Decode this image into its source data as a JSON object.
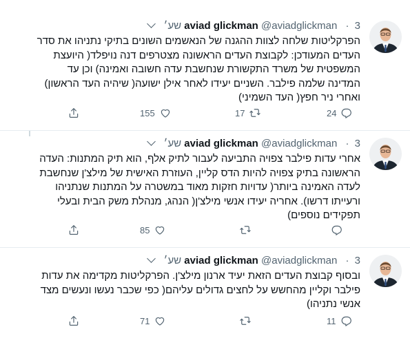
{
  "tweets": [
    {
      "name": "aviad glickman",
      "handle": "@aviadglickman",
      "separator": "·",
      "time": "3 שע׳",
      "text": "הפרקליטות שלחה לצוות ההגנה של הנאשמים השונים בתיקי נתניהו את סדר העדים המעודכן: לקבוצת העדים הראשונה מצטרפים דנה נויפלד( היועצת המשפטית של משרד התקשורת שנחשבת עדה חשובה ואמינה) וכן עד המדינה שלמה פילבר. השניים יעידו לאחר אילן ישועה( שיהיה העד הראשון) ואחרי ניר חפץ( העד השמיני)",
      "replies": "24",
      "retweets": "17",
      "likes": "155"
    },
    {
      "name": "aviad glickman",
      "handle": "@aviadglickman",
      "separator": "·",
      "time": "3 שע׳",
      "text": "אחרי עדות פילבר צפויה התביעה לעבור לתיק אלף, הוא תיק המתנות: העדה הראשונה בתיק צפויה להיות הדס קליין, העוזרת האישית של מילצ'ן שנחשבת לעדה האמינה ביותר( עדויות חזקות מאוד במשטרה על המתנות שנתניהו ורעייתו דרשו). אחריה יעידו אנשי מילצ'ן( הנהג, מנהלת משק הבית ובעלי תפקידים נוספים)",
      "replies": "",
      "retweets": "",
      "likes": "85"
    },
    {
      "name": "aviad glickman",
      "handle": "@aviadglickman",
      "separator": "·",
      "time": "3 שע׳",
      "text": "ובסוף קבוצת העדים הזאת יעיד ארנון מילצ'ן. הפרקליטות מקדימה את עדות פילבר וקליין מהחשש על לחצים גדולים עליהם( כפי שכבר נעשו ונעשים מצד אנשי נתניהו)",
      "replies": "11",
      "retweets": "",
      "likes": "71"
    }
  ],
  "icons": {
    "reply": "reply-icon",
    "retweet": "retweet-icon",
    "like": "heart-icon",
    "share": "share-icon",
    "more": "chevron-down-icon"
  },
  "colors": {
    "text": "#0f1419",
    "secondary": "#536471",
    "divider": "#e6ecf0",
    "thread_line": "#cfd9de"
  }
}
